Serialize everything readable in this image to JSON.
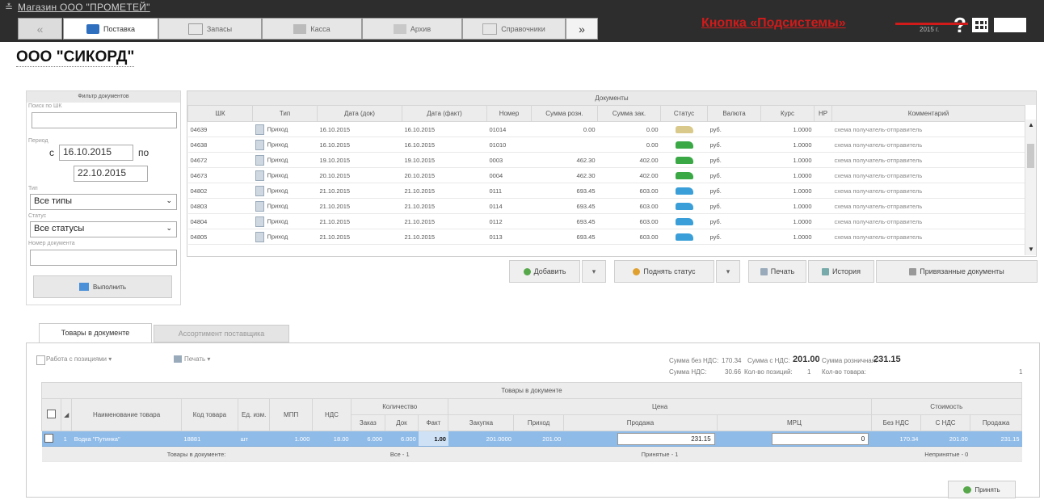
{
  "header": {
    "app_title": "Магазин ООО \"ПРОМЕТЕЙ\"",
    "tabs": [
      {
        "label": "Поставка",
        "active": true
      },
      {
        "label": "Запасы",
        "active": false
      },
      {
        "label": "Касса",
        "active": false
      },
      {
        "label": "Архив",
        "active": false
      },
      {
        "label": "Справочники",
        "active": false
      }
    ],
    "back_glyph": "«",
    "more_glyph": "»",
    "annotation": "Кнопка «Подсистемы»",
    "year_fragment": "2015 г.",
    "icons": [
      "help-icon",
      "subsystems-grid-icon",
      "user-card-icon"
    ]
  },
  "org_title": "ООО \"СИКОРД\"",
  "filter": {
    "title": "Фильтр документов",
    "search_label": "Поиск по ШК",
    "search_value": "",
    "period_label": "Период",
    "from_prefix": "с",
    "from_date": "16.10.2015",
    "to_prefix": "по",
    "to_date": "22.10.2015",
    "type_label": "Тип",
    "type_value": "Все типы",
    "status_label": "Статус",
    "status_value": "Все статусы",
    "docnum_label": "Номер документа",
    "docnum_value": "",
    "execute_label": "Выполнить"
  },
  "documents": {
    "title": "Документы",
    "columns": [
      "ШК",
      "Тип",
      "Дата (док)",
      "Дата (факт)",
      "Номер",
      "Сумма розн.",
      "Сумма зак.",
      "Статус",
      "Валюта",
      "Курс",
      "НР",
      "Комментарий"
    ],
    "rows": [
      {
        "shk": "04639",
        "type": "Приход",
        "date_doc": "16.10.2015",
        "date_fact": "16.10.2015",
        "num": "01014",
        "sum_retail": "0.00",
        "sum_purchase": "0.00",
        "status_color": "#d9c98a",
        "currency": "руб.",
        "rate": "1.0000",
        "comment": "схема получатель-отправитель"
      },
      {
        "shk": "04638",
        "type": "Приход",
        "date_doc": "16.10.2015",
        "date_fact": "16.10.2015",
        "num": "01010",
        "sum_retail": "",
        "sum_purchase": "0.00",
        "status_color": "#3aa845",
        "currency": "руб.",
        "rate": "1.0000",
        "comment": "схема получатель-отправитель"
      },
      {
        "shk": "04672",
        "type": "Приход",
        "date_doc": "19.10.2015",
        "date_fact": "19.10.2015",
        "num": "0003",
        "sum_retail": "462.30",
        "sum_purchase": "402.00",
        "status_color": "#3aa845",
        "currency": "руб.",
        "rate": "1.0000",
        "comment": "схема получатель-отправитель"
      },
      {
        "shk": "04673",
        "type": "Приход",
        "date_doc": "20.10.2015",
        "date_fact": "20.10.2015",
        "num": "0004",
        "sum_retail": "462.30",
        "sum_purchase": "402.00",
        "status_color": "#3aa845",
        "currency": "руб.",
        "rate": "1.0000",
        "comment": "схема получатель-отправитель"
      },
      {
        "shk": "04802",
        "type": "Приход",
        "date_doc": "21.10.2015",
        "date_fact": "21.10.2015",
        "num": "0111",
        "sum_retail": "693.45",
        "sum_purchase": "603.00",
        "status_color": "#3a9fd8",
        "currency": "руб.",
        "rate": "1.0000",
        "comment": "схема получатель-отправитель"
      },
      {
        "shk": "04803",
        "type": "Приход",
        "date_doc": "21.10.2015",
        "date_fact": "21.10.2015",
        "num": "0114",
        "sum_retail": "693.45",
        "sum_purchase": "603.00",
        "status_color": "#3a9fd8",
        "currency": "руб.",
        "rate": "1.0000",
        "comment": "схема получатель-отправитель"
      },
      {
        "shk": "04804",
        "type": "Приход",
        "date_doc": "21.10.2015",
        "date_fact": "21.10.2015",
        "num": "0112",
        "sum_retail": "693.45",
        "sum_purchase": "603.00",
        "status_color": "#3a9fd8",
        "currency": "руб.",
        "rate": "1.0000",
        "comment": "схема получатель-отправитель"
      },
      {
        "shk": "04805",
        "type": "Приход",
        "date_doc": "21.10.2015",
        "date_fact": "21.10.2015",
        "num": "0113",
        "sum_retail": "693.45",
        "sum_purchase": "603.00",
        "status_color": "#3a9fd8",
        "currency": "руб.",
        "rate": "1.0000",
        "comment": "схема получатель-отправитель"
      }
    ]
  },
  "actions": {
    "add": "Добавить",
    "raise_status": "Поднять статус",
    "print": "Печать",
    "history": "История",
    "linked": "Привязанные документы"
  },
  "bottom": {
    "tab_active": "Товары в документе",
    "tab_other": "Ассортимент поставщика",
    "work_positions": "Работа с позициями ▾",
    "print": "Печать ▾",
    "sum_no_vat_label": "Сумма без НДС:",
    "sum_no_vat": "170.34",
    "sum_with_vat_label": "Сумма с НДС:",
    "sum_with_vat": "201.00",
    "sum_retail_label": "Сумма розничная:",
    "sum_retail": "231.15",
    "vat_sum_label": "Сумма НДС:",
    "vat_sum": "30.66",
    "positions_label": "Кол-во позиций:",
    "positions": "1",
    "goods_count_label": "Кол-во товара:",
    "goods_count": "1"
  },
  "goods": {
    "title": "Товары в документе",
    "col_name": "Наименование товара",
    "col_code": "Код товара",
    "col_unit": "Ед. изм.",
    "col_mpp": "МПП",
    "col_vat": "НДС",
    "grp_qty": "Количество",
    "grp_price": "Цена",
    "grp_cost": "Стоимость",
    "qty_order": "Заказ",
    "qty_doc": "Док",
    "qty_fact": "Факт",
    "price_purchase": "Закупка",
    "price_income": "Приход",
    "price_sale": "Продажа",
    "price_mrc": "МРЦ",
    "cost_no_vat": "Без НДС",
    "cost_vat": "С НДС",
    "cost_sale": "Продажа",
    "row": {
      "num": "1",
      "name": "Водка \"Путинка\"",
      "code": "18881",
      "unit": "шт",
      "mpp": "1.000",
      "vat": "18.00",
      "qty_order": "6.000",
      "qty_doc": "6.000",
      "qty_fact": "1.00",
      "purchase": "201.0000",
      "income": "201.00",
      "sale": "231.15",
      "mrc": "0",
      "cost_no_vat": "170.34",
      "cost_vat": "201.00",
      "cost_sale": "231.15"
    },
    "footer_docs": "Товары в документе:",
    "footer_all": "Все - 1",
    "footer_accepted": "Принятые - 1",
    "footer_unaccepted": "Непринятые - 0"
  },
  "accept_label": "Принять"
}
